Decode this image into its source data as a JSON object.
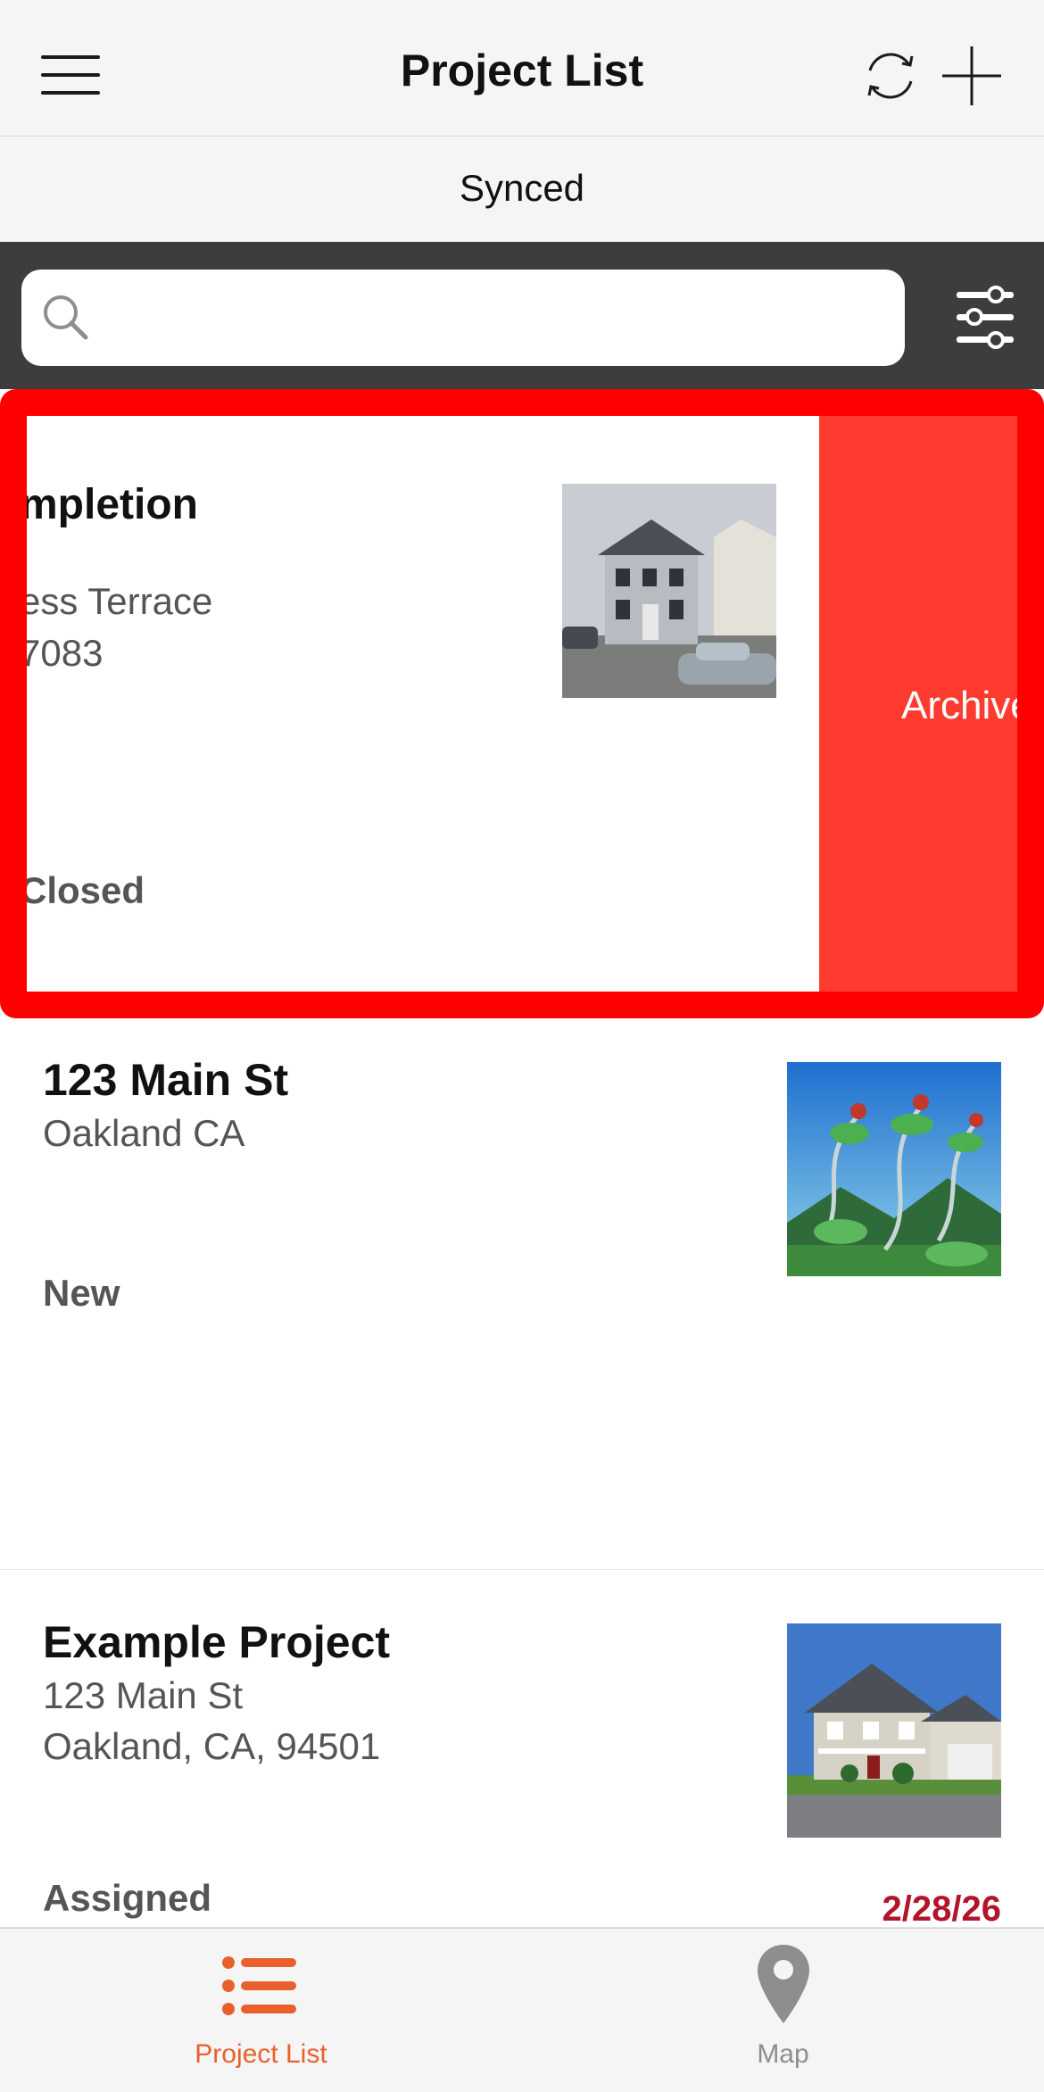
{
  "header": {
    "title": "Project List",
    "menu_icon": "hamburger-menu-icon",
    "sync_icon": "sync-icon",
    "add_icon": "plus-icon"
  },
  "sync_status": "Synced",
  "search": {
    "placeholder": "",
    "value": "",
    "icon": "search-icon",
    "filter_icon": "filter-sliders-icon"
  },
  "swiped_project": {
    "title_fragment": "mpletion",
    "address_line1_fragment": "ess Terrace",
    "address_line2_fragment": "7083",
    "status_fragment": "Closed",
    "archive_label": "Archive",
    "highlight_color": "#ff0000",
    "archive_color": "#ff3b30"
  },
  "projects": [
    {
      "title": "123 Main St",
      "address_line1": "Oakland CA",
      "address_line2": "",
      "status": "New",
      "date": ""
    },
    {
      "title": "Example Project",
      "address_line1": "123 Main St",
      "address_line2": "Oakland, CA, 94501",
      "status": "Assigned",
      "date": "2/28/26"
    }
  ],
  "tabs": [
    {
      "label": "Project List",
      "icon": "list-icon",
      "active": true
    },
    {
      "label": "Map",
      "icon": "map-pin-icon",
      "active": false
    }
  ],
  "colors": {
    "accent": "#e8612c",
    "date": "#b3142a",
    "search_bar_bg": "#3d3d3d"
  }
}
